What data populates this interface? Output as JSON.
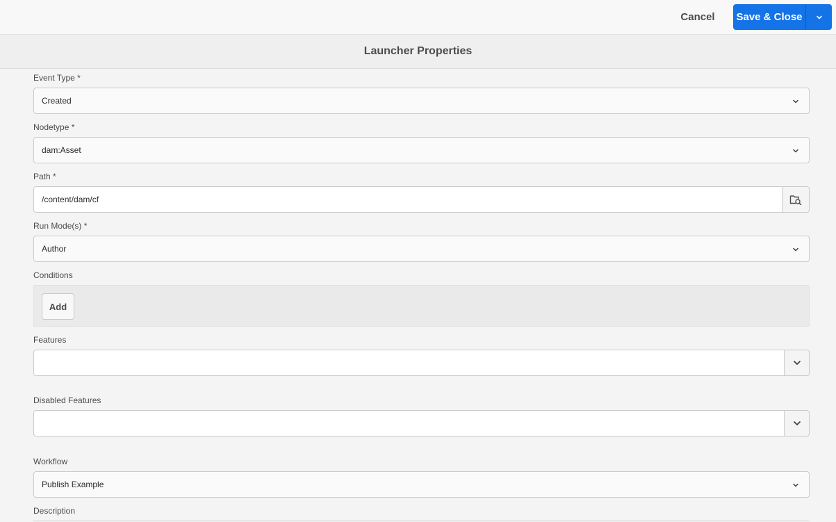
{
  "header": {
    "cancel_label": "Cancel",
    "save_label": "Save & Close",
    "save_menu_icon": "chevron-down-icon",
    "accent_color": "#1473e6"
  },
  "dialog": {
    "title": "Launcher Properties"
  },
  "form": {
    "event_type": {
      "label": "Event Type *",
      "value": "Created"
    },
    "nodetype": {
      "label": "Nodetype *",
      "value": "dam:Asset"
    },
    "path": {
      "label": "Path *",
      "value": "/content/dam/cf",
      "browse_icon": "folder-search-icon"
    },
    "run_modes": {
      "label": "Run Mode(s) *",
      "value": "Author"
    },
    "conditions": {
      "label": "Conditions",
      "add_label": "Add"
    },
    "features": {
      "label": "Features",
      "value": ""
    },
    "disabled_features": {
      "label": "Disabled Features",
      "value": ""
    },
    "workflow": {
      "label": "Workflow",
      "value": "Publish Example"
    },
    "description": {
      "label": "Description"
    }
  }
}
